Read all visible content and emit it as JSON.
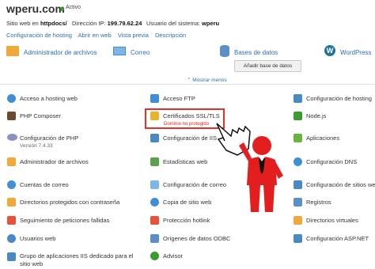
{
  "header": {
    "site_title": "wperu.com",
    "status": "Activo",
    "website_label": "Sitio web en",
    "website_path": "httpdocs/",
    "ip_label": "Dirección IP:",
    "ip_value": "199.79.62.24",
    "user_label": "Usuario del sistema:",
    "user_value": "wperu"
  },
  "links": [
    "Configuración de hosting",
    "Abrir en web",
    "Vista previa",
    "Descripción"
  ],
  "features": {
    "file_manager": "Administrador de archivos",
    "mail": "Correo",
    "databases": "Bases de datos",
    "add_database": "Añadir base de datos",
    "wordpress": "WordPress"
  },
  "show_less": "⌃ Mostrar menos",
  "ssl_warning": "Dominio no protegido",
  "tools": [
    {
      "label": "Acceso a hosting web"
    },
    {
      "label": "Acceso FTP"
    },
    {
      "label": "Configuración de hosting"
    },
    {
      "label": "PHP Composer"
    },
    {
      "label": "Certificados SSL/TLS"
    },
    {
      "label": "Node.js"
    },
    {
      "label": "Configuración de PHP",
      "sub": "Versión 7.4.33"
    },
    {
      "label": "Configuración de IIS"
    },
    {
      "label": "Aplicaciones"
    },
    {
      "label": "Administrador de archivos"
    },
    {
      "label": "Estadísticas web"
    },
    {
      "label": "Configuración DNS"
    },
    {
      "label": "Cuentas de correo"
    },
    {
      "label": "Configuración de correo"
    },
    {
      "label": "Configuración de sitios web"
    },
    {
      "label": "Directorios protegidos con contraseña"
    },
    {
      "label": "Copia de sitio web"
    },
    {
      "label": "Registros"
    },
    {
      "label": "Seguimiento de peticiones fallidas"
    },
    {
      "label": "Protección hotlink"
    },
    {
      "label": "Directorios virtuales"
    },
    {
      "label": "Usuarios web"
    },
    {
      "label": "Orígenes de datos ODBC"
    },
    {
      "label": "Configuración ASP.NET"
    },
    {
      "label": "Grupo de aplicaciones IIS dedicado para el"
    },
    {
      "label": "Advisor"
    }
  ],
  "tools_extra": {
    "iis_pool_line2": "sitio web"
  },
  "colors": {
    "accent": "#2a6fb5",
    "alert": "#e0312b",
    "status": "#3a9b2f"
  }
}
